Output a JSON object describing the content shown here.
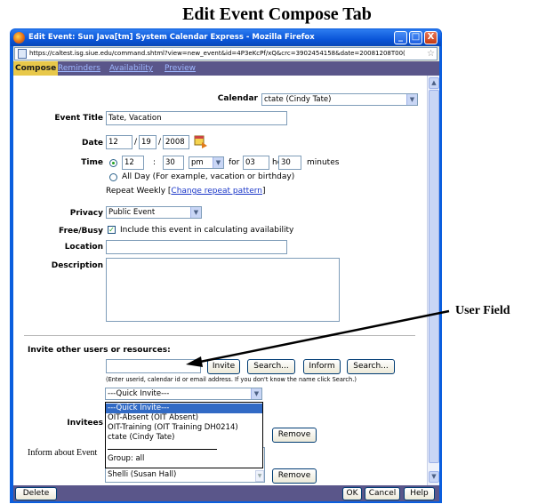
{
  "doc_title": "Edit Event Compose Tab",
  "window": {
    "title": "Edit Event: Sun Java[tm] System Calendar Express - Mozilla Firefox",
    "url": "https://caltest.isg.siue.edu/command.shtml?view=new_event&id=4P3eKcPf/xQ&crc=3902454158&date=20081208T00(",
    "minimize": "_",
    "maximize": "□",
    "close": "X"
  },
  "tabs": [
    "Compose",
    "Reminders",
    "Availability",
    "Preview"
  ],
  "form": {
    "calendar_label": "Calendar",
    "calendar_value": "ctate (Cindy Tate)",
    "event_title_label": "Event Title",
    "event_title_value": "Tate, Vacation",
    "date_label": "Date",
    "date_month": "12",
    "date_day": "19",
    "date_year": "2008",
    "date_sep": "/",
    "time_label": "Time",
    "time_hour": "12",
    "time_colon": ":",
    "time_min": "30",
    "time_ampm": "pm",
    "time_for": "for",
    "duration_hours": "03",
    "hour_label": "hour",
    "duration_minutes": "30",
    "minutes_label": "minutes",
    "all_day_label": "All Day (For example, vacation or birthday)",
    "repeat_text": "Repeat Weekly [",
    "repeat_link": "Change repeat pattern",
    "repeat_close": "]",
    "privacy_label": "Privacy",
    "privacy_value": "Public Event",
    "freebusy_label": "Free/Busy",
    "freebusy_text": "Include this event in calculating availability",
    "location_label": "Location",
    "location_value": "",
    "description_label": "Description",
    "description_value": ""
  },
  "invite": {
    "heading": "Invite other users or resources:",
    "input_value": "",
    "invite_btn": "Invite",
    "search_btn_1": "Search...",
    "inform_btn": "Inform",
    "search_btn_2": "Search...",
    "hint": "(Enter userid, calendar id or email address. If you don't know the name click Search.)",
    "quick_invite_value": "---Quick Invite---",
    "invitees_label": "Invitees",
    "remove_btn_1": "Remove",
    "inform_label": "Inform about Event",
    "partial_entry": "Shelli (Susan Hall)",
    "remove_btn_2": "Remove"
  },
  "quick_invite_options": [
    "---Quick Invite---",
    "OIT-Absent (OIT Absent)",
    "OIT-Training (OIT Training DH0214)",
    "ctate (Cindy Tate)",
    "Group: all"
  ],
  "bottom": {
    "delete_btn": "Delete",
    "ok_btn": "OK",
    "cancel_btn": "Cancel",
    "help_btn": "Help"
  },
  "annotation": {
    "label": "User Field"
  },
  "colors": {
    "titlebar": "#0a55d8",
    "tabbar": "#5a568a",
    "active_tab": "#e8c84a",
    "inactive_tab_text": "#9fb8ff",
    "highlight": "#316ac5"
  }
}
